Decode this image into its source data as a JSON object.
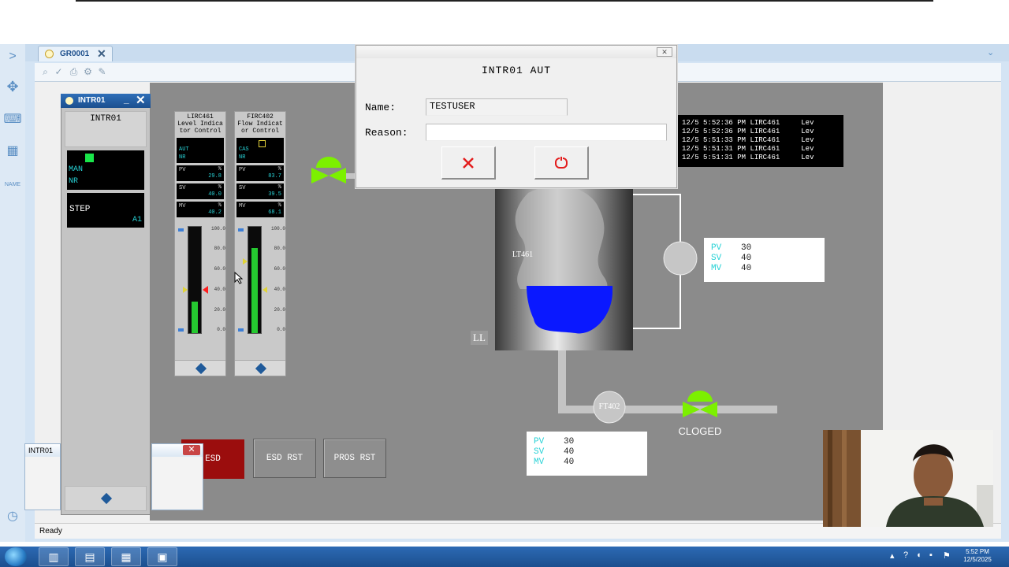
{
  "window": {
    "tab_label": "GR0001",
    "status_text": "Ready",
    "side_label": "NAME"
  },
  "faceplate": {
    "title": "INTR01",
    "header": "INTR01",
    "mode": "MAN",
    "mode2": "NR",
    "step_label": "STEP",
    "step_value": "A1"
  },
  "instruments": [
    {
      "tag": "LIRC461",
      "desc1": "Level Indica",
      "desc2": "tor Control",
      "mode1": "AUT",
      "mode2": "NR",
      "pv": "29.8",
      "sv": "40.0",
      "mv": "40.2",
      "unit": "%",
      "bar_fraction": 0.3
    },
    {
      "tag": "FIRC402",
      "desc1": "Flow Indicat",
      "desc2": "or Control",
      "mode1": "CAS",
      "mode2": "NR",
      "pv": "83.7",
      "sv": "39.5",
      "mv": "68.1",
      "unit": "%",
      "bar_fraction": 0.8
    }
  ],
  "scale": [
    "100.0",
    "80.0",
    "60.0",
    "40.0",
    "20.0",
    "0.0"
  ],
  "alarms": [
    {
      "date": "12/5",
      "time": "5:52:36 PM",
      "tag": "LIRC461",
      "msg": "Lev"
    },
    {
      "date": "12/5",
      "time": "5:52:36 PM",
      "tag": "LIRC461",
      "msg": "Lev"
    },
    {
      "date": "12/5",
      "time": "5:51:33 PM",
      "tag": "LIRC461",
      "msg": "Lev"
    },
    {
      "date": "12/5",
      "time": "5:51:31 PM",
      "tag": "LIRC461",
      "msg": "Lev"
    },
    {
      "date": "12/5",
      "time": "5:51:31 PM",
      "tag": "LIRC461",
      "msg": "Lev"
    }
  ],
  "level_panel": {
    "pv_label": "PV",
    "pv": "30",
    "sv_label": "SV",
    "sv": "40",
    "mv_label": "MV",
    "mv": "40"
  },
  "flow_panel": {
    "pv_label": "PV",
    "pv": "30",
    "sv_label": "SV",
    "sv": "40",
    "mv_label": "MV",
    "mv": "40"
  },
  "process": {
    "lt_tag": "LT461",
    "ft_tag": "FT402",
    "ll_label": "LL",
    "valve_state": "CLOGED",
    "tank_level_fraction": 0.3
  },
  "buttons": {
    "esd": "ESD",
    "esd_rst": "ESD RST",
    "pros_rst": "PROS RST"
  },
  "mini_window": {
    "title": "INTR01"
  },
  "dialog": {
    "title": "INTR01 AUT",
    "name_label": "Name:",
    "name_value": "TESTUSER",
    "reason_label": "Reason:",
    "reason_value": ""
  },
  "taskbar": {
    "time": "5:52 PM",
    "date": "12/5/2025"
  },
  "colors": {
    "accent_cyan": "#28d2d6",
    "valve_green": "#7cf000",
    "tank_liquid": "#0a18ff",
    "esd_red": "#9b0d0d"
  }
}
